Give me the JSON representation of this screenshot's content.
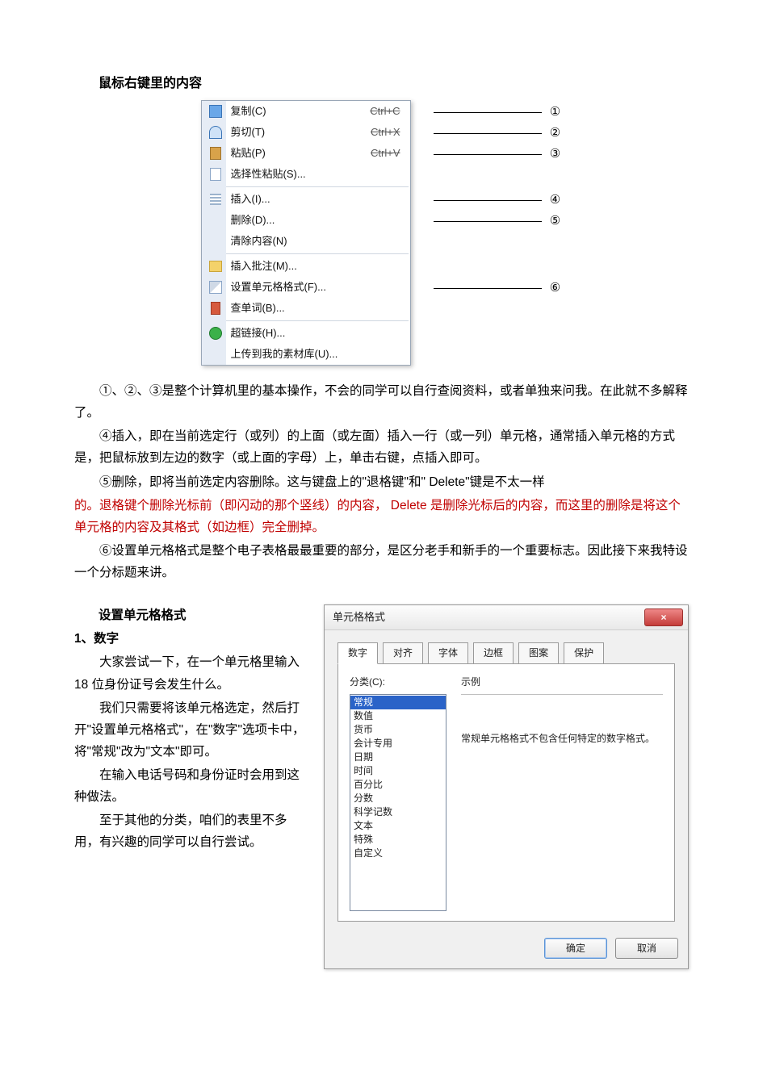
{
  "section1": {
    "title": "鼠标右键里的内容",
    "paragraphs": [
      "①、②、③是整个计算机里的基本操作，不会的同学可以自行查阅资料，或者单独来问我。在此就不多解释了。",
      "④插入，即在当前选定行（或列）的上面（或左面）插入一行（或一列）单元格，通常插入单元格的方式是，把鼠标放到左边的数字（或上面的字母）上，单击右键，点插入即可。",
      "⑤删除，即将当前选定内容删除。这与键盘上的\"退格键\"和\" Delete\"键是不太一样",
      "⑥设置单元格格式是整个电子表格最最重要的部分，是区分老手和新手的一个重要标志。因此接下来我特设一个分标题来讲。"
    ],
    "redPara": "的。退格键个删除光标前（即闪动的那个竖线）的内容， Delete 是删除光标后的内容，而这里的删除是将这个单元格的内容及其格式（如边框）完全删掉。"
  },
  "contextMenu": {
    "items": [
      {
        "label": "复制(C)",
        "shortcut": "Ctrl+C",
        "icon": "copy",
        "callout": "①"
      },
      {
        "label": "剪切(T)",
        "shortcut": "Ctrl+X",
        "icon": "cut",
        "callout": "②"
      },
      {
        "label": "粘贴(P)",
        "shortcut": "Ctrl+V",
        "icon": "paste",
        "callout": "③"
      },
      {
        "label": "选择性粘贴(S)...",
        "shortcut": "",
        "icon": "sel",
        "callout": ""
      },
      {
        "sep": true
      },
      {
        "label": "插入(I)...",
        "shortcut": "",
        "icon": "grid",
        "callout": "④"
      },
      {
        "label": "删除(D)...",
        "shortcut": "",
        "icon": "",
        "callout": "⑤"
      },
      {
        "label": "清除内容(N)",
        "shortcut": "",
        "icon": "",
        "callout": ""
      },
      {
        "sep": true
      },
      {
        "label": "插入批注(M)...",
        "shortcut": "",
        "icon": "note",
        "callout": ""
      },
      {
        "label": "设置单元格格式(F)...",
        "shortcut": "",
        "icon": "fmt",
        "callout": "⑥"
      },
      {
        "label": "查单词(B)...",
        "shortcut": "",
        "icon": "dict",
        "callout": ""
      },
      {
        "sep": true
      },
      {
        "label": "超链接(H)...",
        "shortcut": "",
        "icon": "globe",
        "callout": ""
      },
      {
        "label": "上传到我的素材库(U)...",
        "shortcut": "",
        "icon": "",
        "callout": ""
      }
    ]
  },
  "section2": {
    "title": "设置单元格格式",
    "heading": "1、数字",
    "paragraphs": [
      "大家尝试一下，在一个单元格里输入 18 位身份证号会发生什么。",
      "我们只需要将该单元格选定，然后打开\"设置单元格格式\"，在\"数字\"选项卡中，将\"常规\"改为\"文本\"即可。",
      "在输入电话号码和身份证时会用到这种做法。",
      "至于其他的分类，咱们的表里不多用，有兴趣的同学可以自行尝试。"
    ]
  },
  "dialog": {
    "title": "单元格格式",
    "close": "×",
    "tabs": [
      "数字",
      "对齐",
      "字体",
      "边框",
      "图案",
      "保护"
    ],
    "activeTab": 0,
    "categoryLabel": "分类(C):",
    "exampleLabel": "示例",
    "categories": [
      "常规",
      "数值",
      "货币",
      "会计专用",
      "日期",
      "时间",
      "百分比",
      "分数",
      "科学记数",
      "文本",
      "特殊",
      "自定义"
    ],
    "selectedCategory": 0,
    "hint": "常规单元格格式不包含任何特定的数字格式。",
    "buttons": {
      "ok": "确定",
      "cancel": "取消"
    }
  }
}
